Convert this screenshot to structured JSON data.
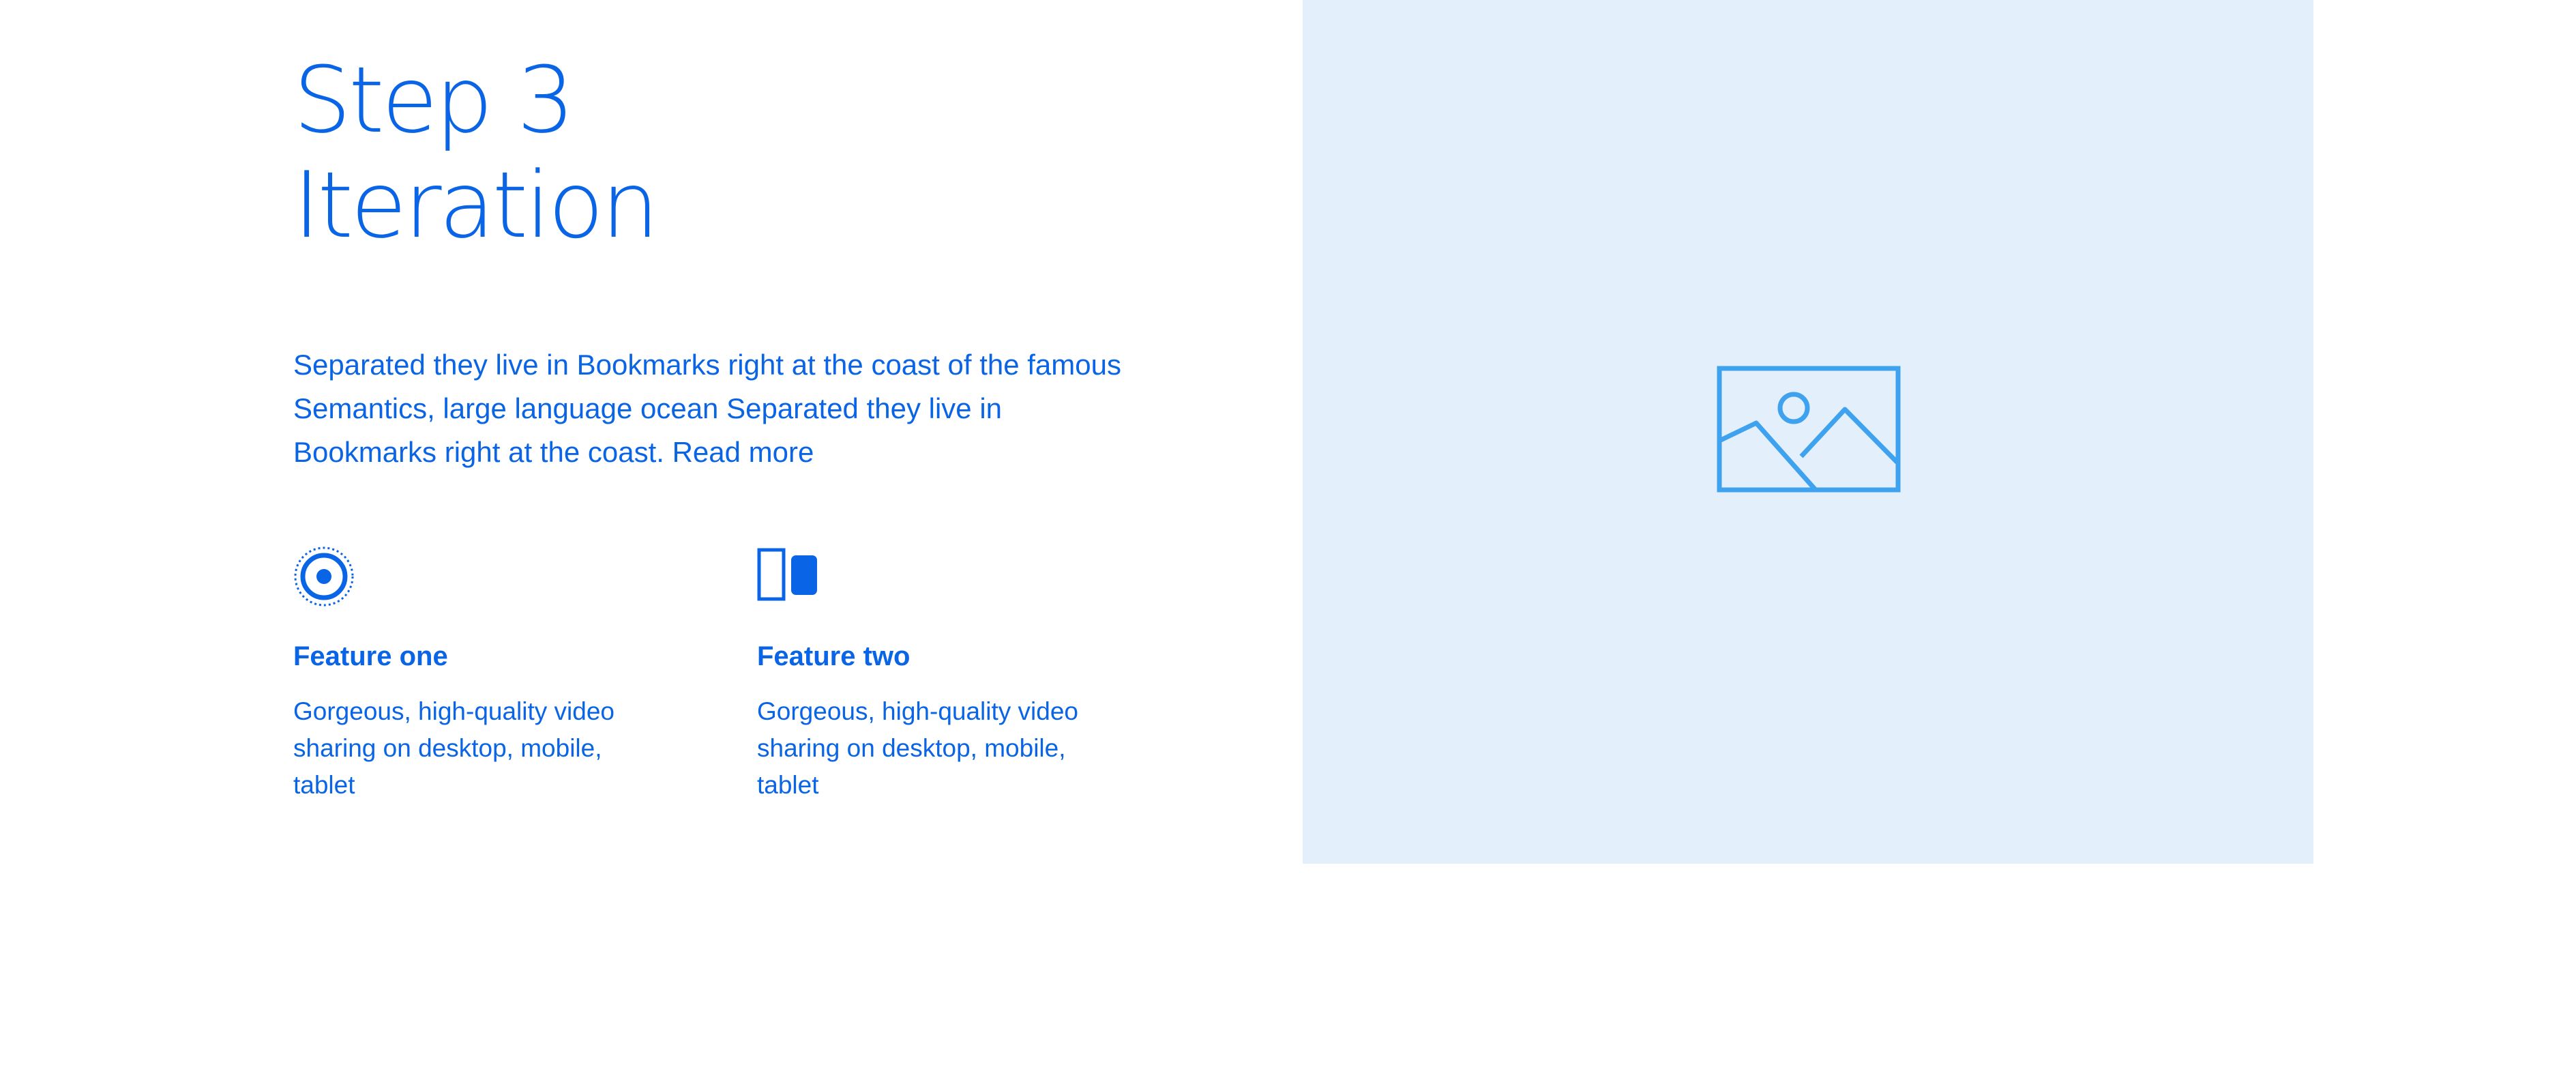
{
  "hero": {
    "title_line1": "Step 3",
    "title_line2": "Iteration",
    "intro_text": "Separated they live in Bookmarks right at the coast of the famous Semantics, large language ocean Separated they live in Bookmarks right at the coast.",
    "read_more": "Read more"
  },
  "features": [
    {
      "icon": "target-icon",
      "title": "Feature one",
      "description": "Gorgeous, high-quality video sharing on desktop, mobile, tablet"
    },
    {
      "icon": "devices-icon",
      "title": "Feature two",
      "description": "Gorgeous, high-quality video sharing on desktop, mobile, tablet"
    }
  ],
  "media": {
    "icon": "image-placeholder-icon",
    "background": "#e3f0fc",
    "icon_color": "#3fa2ee"
  },
  "colors": {
    "accent": "#0a64e6",
    "background": "#ffffff"
  }
}
